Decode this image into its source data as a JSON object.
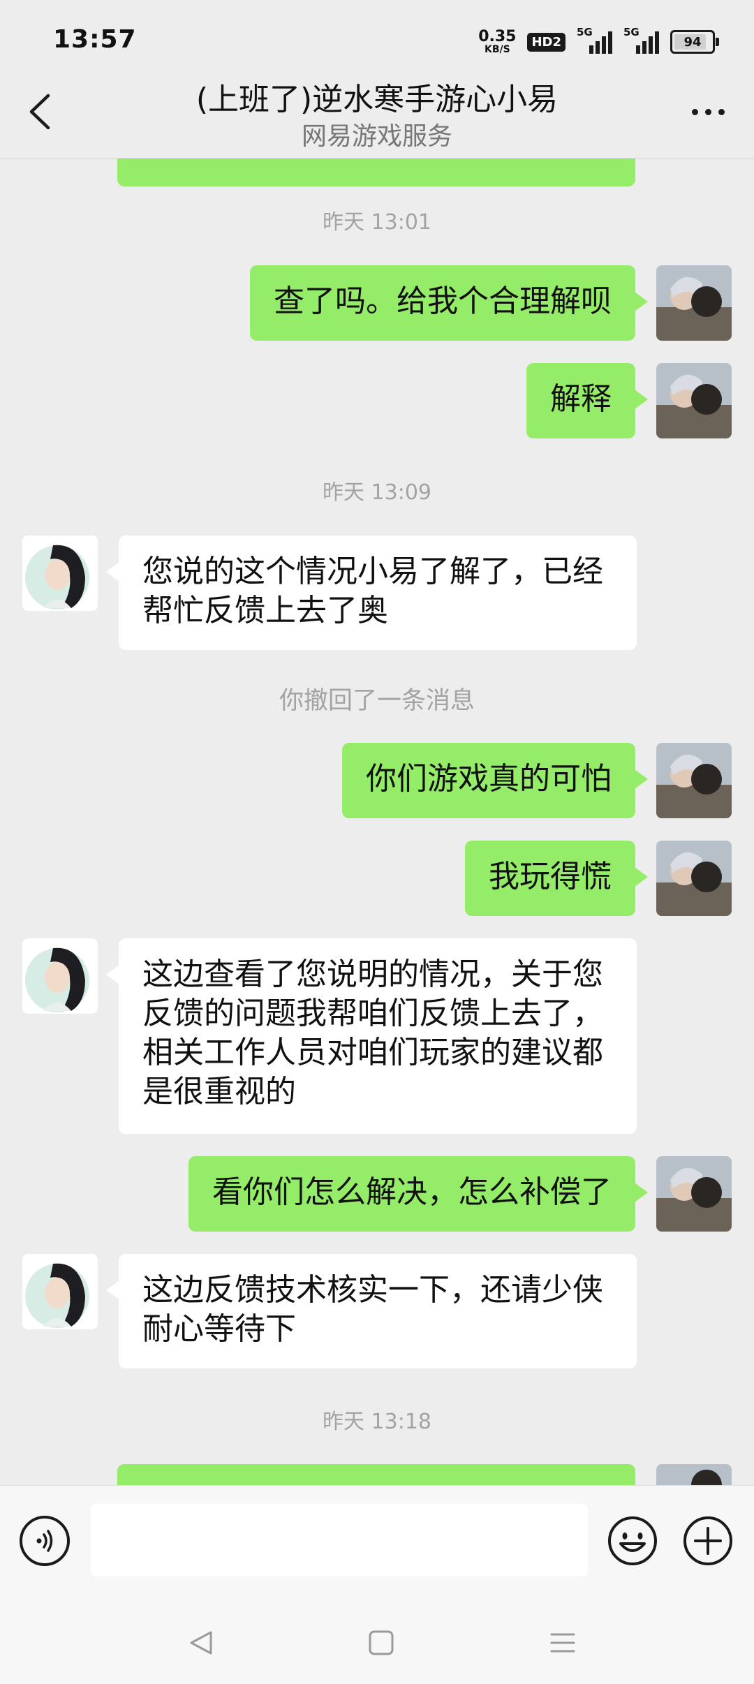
{
  "status_bar": {
    "time": "13:57",
    "net_speed_value": "0.35",
    "net_speed_unit": "KB/S",
    "hd_badge": "HD2",
    "sim1_label": "5G",
    "sim2_label": "5G",
    "battery": "94"
  },
  "header": {
    "title": "(上班了)逆水寒手游心小易",
    "subtitle": "网易游戏服务",
    "back_icon": "chevron-left-icon",
    "more_icon": "more-dots-icon"
  },
  "messages": [
    {
      "type": "timestamp",
      "text": "昨天 13:01"
    },
    {
      "type": "outgoing",
      "text": "查了吗。给我个合理解呗"
    },
    {
      "type": "outgoing",
      "text": "解释"
    },
    {
      "type": "timestamp",
      "text": "昨天 13:09"
    },
    {
      "type": "incoming",
      "text": "您说的这个情况小易了解了，已经帮忙反馈上去了奥"
    },
    {
      "type": "system",
      "text": "你撤回了一条消息"
    },
    {
      "type": "outgoing",
      "text": "你们游戏真的可怕"
    },
    {
      "type": "outgoing",
      "text": "我玩得慌"
    },
    {
      "type": "incoming",
      "text": "这边查看了您说明的情况，关于您反馈的问题我帮咱们反馈上去了，相关工作人员对咱们玩家的建议都是很重视的"
    },
    {
      "type": "outgoing",
      "text": "看你们怎么解决，怎么补偿了"
    },
    {
      "type": "incoming",
      "text": "这边反馈技术核实一下，还请少侠耐心等待下"
    },
    {
      "type": "timestamp",
      "text": "昨天 13:18"
    }
  ],
  "input_bar": {
    "value": "",
    "voice_icon": "voice-icon",
    "emoji_icon": "emoji-icon",
    "plus_icon": "plus-icon"
  },
  "nav_bar": {
    "back_icon": "nav-back-icon",
    "home_icon": "nav-home-icon",
    "menu_icon": "nav-menu-icon"
  },
  "colors": {
    "background": "#ededed",
    "outgoing_bubble": "#95ec69",
    "incoming_bubble": "#ffffff",
    "timestamp_text": "#a3a3a3"
  }
}
